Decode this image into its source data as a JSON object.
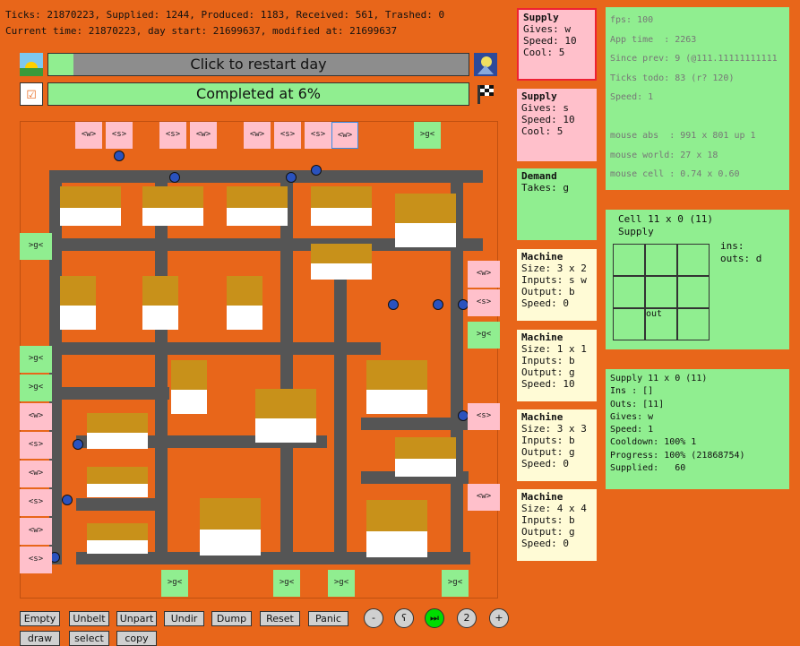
{
  "stats": {
    "line1": "Ticks: 21870223, Supplied: 1244, Produced: 1183, Received: 561, Trashed: 0",
    "line2": "Current time: 21870223, day start: 21699637, modified at: 21699637"
  },
  "restart_bar": {
    "label": "Click to restart day",
    "progress": 0.06
  },
  "completed_bar": {
    "label": "Completed at 6%",
    "progress": 1.0
  },
  "checkbox": {
    "mark": "☑"
  },
  "icons": {
    "sunrise": "sunrise-icon",
    "moon": "moon-icon",
    "finish": "checkered-flag-icon"
  },
  "ports": {
    "top": [
      {
        "label": "<w>"
      },
      {
        "label": "<s>"
      },
      {
        "label": "<s>"
      },
      {
        "label": "<w>"
      },
      {
        "label": "<w>"
      },
      {
        "label": "<s>"
      },
      {
        "label": "<s>"
      },
      {
        "label": "<w>"
      },
      {
        "label": ">g<"
      }
    ],
    "left": [
      {
        "label": ">g<"
      },
      {
        "label": ">g<"
      },
      {
        "label": ">g<"
      },
      {
        "label": "<w>"
      },
      {
        "label": "<s>"
      },
      {
        "label": "<w>"
      },
      {
        "label": "<s>"
      },
      {
        "label": "<w>"
      },
      {
        "label": "<s>"
      }
    ],
    "right": [
      {
        "label": "<w>"
      },
      {
        "label": "<s>"
      },
      {
        "label": ">g<"
      },
      {
        "label": "<s>"
      },
      {
        "label": "<w>"
      }
    ],
    "bottom": [
      {
        "label": ">g<"
      },
      {
        "label": ">g<"
      },
      {
        "label": ">g<"
      },
      {
        "label": ">g<"
      }
    ]
  },
  "cards": [
    {
      "title": "Supply",
      "lines": [
        "Gives: w",
        "Speed: 10",
        "Cool: 5"
      ]
    },
    {
      "title": "Supply",
      "lines": [
        "Gives: s",
        "Speed: 10",
        "Cool: 5"
      ]
    },
    {
      "title": "Demand",
      "lines": [
        "Takes: g"
      ]
    },
    {
      "title": "Machine",
      "lines": [
        "Size: 3 x 2",
        "Inputs: s w",
        "Output: b",
        "Speed: 0"
      ]
    },
    {
      "title": "Machine",
      "lines": [
        "Size: 1 x 1",
        "Inputs: b",
        "Output: g",
        "Speed: 10"
      ]
    },
    {
      "title": "Machine",
      "lines": [
        "Size: 3 x 3",
        "Inputs: b",
        "Output: g",
        "Speed: 0"
      ]
    },
    {
      "title": "Machine",
      "lines": [
        "Size: 4 x 4",
        "Inputs: b",
        "Output: g",
        "Speed: 0"
      ]
    }
  ],
  "debug": {
    "text": "fps: 100\nApp time  : 2263\nSince prev: 9 (@111.11111111111\nTicks todo: 83 (r? 120)\nSpeed: 1\n\nmouse abs  : 991 x 801 up 1\nmouse world: 27 x 18\nmouse cell : 0.74 x 0.60"
  },
  "cell": {
    "title": "Cell 11 x 0 (11)",
    "kind": "Supply",
    "ins": "ins:",
    "outs": "outs: d",
    "out_label": "out"
  },
  "supply_info": {
    "text": "Supply 11 x 0 (11)\nIns : []\nOuts: [11]\nGives: w\nSpeed: 1\nCooldown: 100% 1\nProgress: 100% (21868754)\nSupplied:   60"
  },
  "buttons": {
    "row1": [
      "Empty",
      "Unbelt",
      "Unpart",
      "Undir",
      "Dump",
      "Reset",
      "Panic"
    ],
    "row2": [
      "draw",
      "select",
      "copy"
    ],
    "circles": [
      "-",
      "ʕ",
      "⏭",
      "2",
      "+"
    ]
  },
  "colors": {
    "orange": "#e8661a",
    "green": "#90ee90",
    "pink": "#ffc0cb",
    "cream": "#fffbd6",
    "gold": "#c8911a",
    "belt": "#555555",
    "play": "#00dd00"
  }
}
